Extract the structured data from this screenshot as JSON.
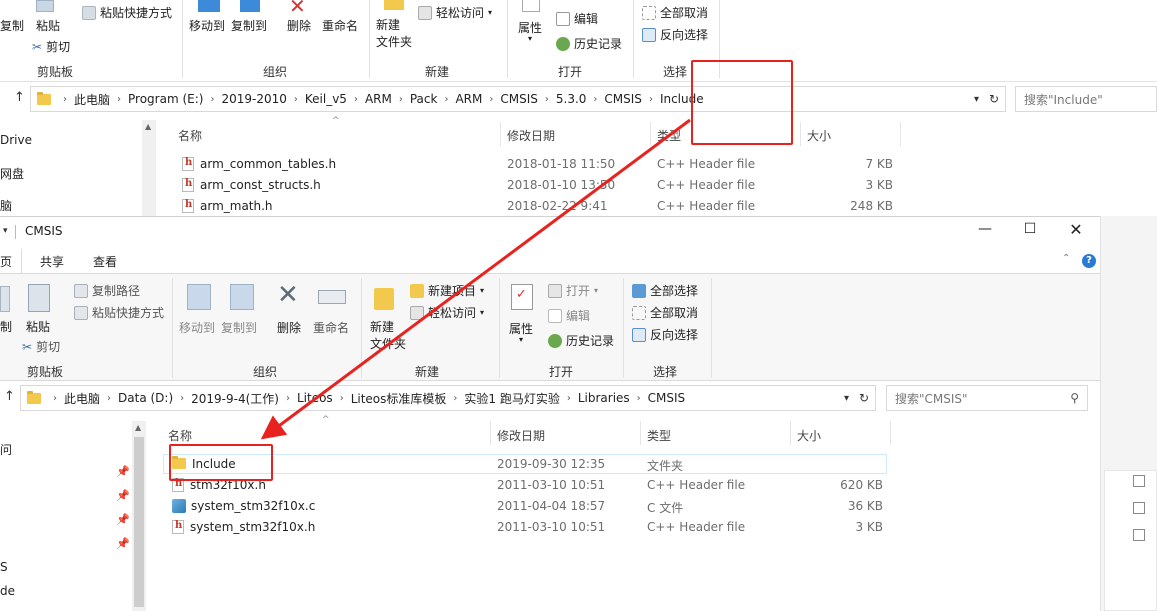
{
  "back_window": {
    "ribbon": {
      "copy_label": "复制",
      "paste_label": "粘贴",
      "paste_shortcut_label": "粘贴快捷方式",
      "cut_label": "剪切",
      "clipboard_group": "剪贴板",
      "move_to_label": "移动到",
      "copy_to_label": "复制到",
      "delete_label": "删除",
      "rename_label": "重命名",
      "organize_group": "组织",
      "new_folder_label": "新建\n文件夹",
      "easy_access_label": "轻松访问",
      "new_group": "新建",
      "properties_label": "属性",
      "edit_label": "编辑",
      "history_label": "历史记录",
      "open_group": "打开",
      "select_none_label": "全部取消",
      "invert_selection_label": "反向选择",
      "select_group": "选择"
    },
    "address": {
      "crumbs": [
        "此电脑",
        "Program (E:)",
        "2019-2010",
        "Keil_v5",
        "ARM",
        "Pack",
        "ARM",
        "CMSIS",
        "5.3.0",
        "CMSIS",
        "Include"
      ]
    },
    "search_placeholder": "搜索\"Include\"",
    "sidebar": [
      "Drive",
      "网盘",
      "脑"
    ],
    "columns": {
      "name": "名称",
      "date": "修改日期",
      "type": "类型",
      "size": "大小"
    },
    "files": [
      {
        "name": "arm_common_tables.h",
        "date": "2018-01-18 11:50",
        "type": "C++ Header file",
        "size": "7 KB"
      },
      {
        "name": "arm_const_structs.h",
        "date": "2018-01-10 13:50",
        "type": "C++ Header file",
        "size": "3 KB"
      },
      {
        "name": "arm_math.h",
        "date": "2018-02-22 9:41",
        "type": "C++ Header file",
        "size": "248 KB"
      }
    ]
  },
  "front_window": {
    "title": "CMSIS",
    "tabs": {
      "home": "页",
      "share": "共享",
      "view": "查看"
    },
    "ribbon": {
      "copy_label": "制",
      "paste_label": "粘贴",
      "copy_path_label": "复制路径",
      "paste_shortcut_label": "粘贴快捷方式",
      "cut_label": "剪切",
      "clipboard_group": "剪贴板",
      "move_to_label": "移动到",
      "copy_to_label": "复制到",
      "delete_label": "删除",
      "rename_label": "重命名",
      "organize_group": "组织",
      "new_item_label": "新建项目",
      "easy_access_label": "轻松访问",
      "new_folder_label": "新建\n文件夹",
      "new_group": "新建",
      "open_label": "打开",
      "edit_label": "编辑",
      "history_label": "历史记录",
      "properties_label": "属性",
      "open_group": "打开",
      "select_all_label": "全部选择",
      "select_none_label": "全部取消",
      "invert_selection_label": "反向选择",
      "select_group": "选择"
    },
    "address": {
      "crumbs": [
        "此电脑",
        "Data (D:)",
        "2019-9-4(工作)",
        "Liteos",
        "Liteos标准库模板",
        "实验1 跑马灯实验",
        "Libraries",
        "CMSIS"
      ]
    },
    "search_placeholder": "搜索\"CMSIS\"",
    "sidebar": [
      "问",
      "S",
      "de"
    ],
    "columns": {
      "name": "名称",
      "date": "修改日期",
      "type": "类型",
      "size": "大小"
    },
    "files": [
      {
        "name": "Include",
        "date": "2019-09-30 12:35",
        "type": "文件夹",
        "size": "",
        "kind": "folder"
      },
      {
        "name": "stm32f10x.h",
        "date": "2011-03-10 10:51",
        "type": "C++ Header file",
        "size": "620 KB",
        "kind": "h"
      },
      {
        "name": "system_stm32f10x.c",
        "date": "2011-04-04 18:57",
        "type": "C 文件",
        "size": "36 KB",
        "kind": "c"
      },
      {
        "name": "system_stm32f10x.h",
        "date": "2011-03-10 10:51",
        "type": "C++ Header file",
        "size": "3 KB",
        "kind": "h"
      }
    ]
  },
  "annotation": {
    "color": "#e8231f"
  }
}
